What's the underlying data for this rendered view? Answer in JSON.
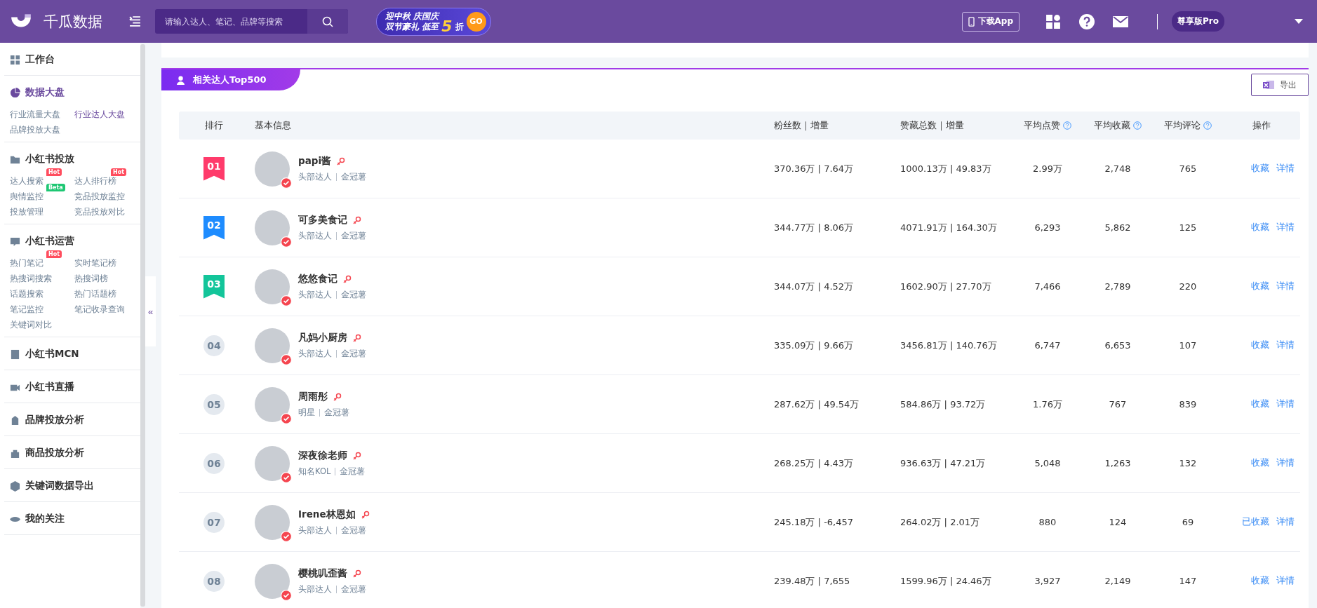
{
  "header": {
    "brand": "千瓜数据",
    "search": {
      "placeholder": "请输入达人、笔记、品牌等搜索"
    },
    "promo": {
      "line_1": "迎中秋 庆国庆",
      "line_2": "双节豪礼 低至",
      "discount": "5",
      "unit": "折",
      "go": "GO"
    },
    "download": "下载App",
    "plan": "尊享版Pro"
  },
  "sidebar": {
    "collapse": "«",
    "sections": [
      {
        "title": "工作台",
        "selected": false
      },
      {
        "title": "数据大盘",
        "selected": true,
        "items": [
          {
            "label": "行业流量大盘",
            "selected": false
          },
          {
            "label": "行业达人大盘",
            "selected": true
          },
          {
            "label": "品牌投放大盘",
            "selected": false
          }
        ]
      },
      {
        "title": "小红书投放",
        "selected": false,
        "items": [
          {
            "label": "达人搜索",
            "selected": false,
            "badge": {
              "text": "Hot",
              "kind": "hot"
            }
          },
          {
            "label": "达人排行榜",
            "selected": false,
            "badge": {
              "text": "Hot",
              "kind": "hot"
            }
          },
          {
            "label": "舆情监控",
            "selected": false,
            "badge": {
              "text": "Beta",
              "kind": "beta"
            }
          },
          {
            "label": "竞品投放监控",
            "selected": false
          },
          {
            "label": "投放管理",
            "selected": false
          },
          {
            "label": "竞品投放对比",
            "selected": false
          }
        ]
      },
      {
        "title": "小红书运营",
        "selected": false,
        "items": [
          {
            "label": "热门笔记",
            "selected": false,
            "badge": {
              "text": "Hot",
              "kind": "hot"
            }
          },
          {
            "label": "实时笔记榜",
            "selected": false
          },
          {
            "label": "热搜词搜索",
            "selected": false
          },
          {
            "label": "热搜词榜",
            "selected": false
          },
          {
            "label": "话题搜索",
            "selected": false
          },
          {
            "label": "热门话题榜",
            "selected": false
          },
          {
            "label": "笔记监控",
            "selected": false
          },
          {
            "label": "笔记收录查询",
            "selected": false
          },
          {
            "label": "关键词对比",
            "selected": false
          }
        ]
      },
      {
        "title": "小红书MCN",
        "selected": false
      },
      {
        "title": "小红书直播",
        "selected": false
      },
      {
        "title": "品牌投放分析",
        "selected": false
      },
      {
        "title": "商品投放分析",
        "selected": false
      },
      {
        "title": "关键词数据导出",
        "selected": false
      },
      {
        "title": "我的关注",
        "selected": false
      }
    ]
  },
  "panel": {
    "tab": "相关达人Top500",
    "export": "导出"
  },
  "table": {
    "columns": [
      {
        "label": "排行",
        "help": false
      },
      {
        "label": "基本信息",
        "help": false
      },
      {
        "label": "粉丝数｜增量",
        "help": false
      },
      {
        "label": "赞藏总数｜增量",
        "help": false
      },
      {
        "label": "平均点赞",
        "help": true
      },
      {
        "label": "平均收藏",
        "help": true
      },
      {
        "label": "平均评论",
        "help": true
      },
      {
        "label": "操作",
        "help": false
      }
    ],
    "rows": [
      {
        "rank": "01",
        "kind": "ribbon",
        "color": "#ff3b6b",
        "name": "papi酱",
        "tags": [
          "头部达人",
          "金冠薯"
        ],
        "fans": "370.36万 | 7.64万",
        "total": "1000.13万 | 49.83万",
        "avg_likes": "2.99万",
        "avg_favs": "2,748",
        "avg_comments": "765",
        "actions": [
          "收藏",
          "详情"
        ]
      },
      {
        "rank": "02",
        "kind": "ribbon",
        "color": "#1e8cff",
        "name": "可多美食记",
        "tags": [
          "头部达人",
          "金冠薯"
        ],
        "fans": "344.77万 | 8.06万",
        "total": "4071.91万 | 164.30万",
        "avg_likes": "6,293",
        "avg_favs": "5,862",
        "avg_comments": "125",
        "actions": [
          "收藏",
          "详情"
        ]
      },
      {
        "rank": "03",
        "kind": "ribbon",
        "color": "#13c59a",
        "name": "悠悠食记",
        "tags": [
          "头部达人",
          "金冠薯"
        ],
        "fans": "344.07万 | 4.52万",
        "total": "1602.90万 | 27.70万",
        "avg_likes": "7,466",
        "avg_favs": "2,789",
        "avg_comments": "220",
        "actions": [
          "收藏",
          "详情"
        ]
      },
      {
        "rank": "04",
        "kind": "circle",
        "name": "凡妈小厨房",
        "tags": [
          "头部达人",
          "金冠薯"
        ],
        "fans": "335.09万 | 9.66万",
        "total": "3456.81万 | 140.76万",
        "avg_likes": "6,747",
        "avg_favs": "6,653",
        "avg_comments": "107",
        "actions": [
          "收藏",
          "详情"
        ]
      },
      {
        "rank": "05",
        "kind": "circle",
        "name": "周雨彤",
        "tags": [
          "明星",
          "金冠薯"
        ],
        "fans": "287.62万 | 49.54万",
        "total": "584.86万 | 93.72万",
        "avg_likes": "1.76万",
        "avg_favs": "767",
        "avg_comments": "839",
        "actions": [
          "收藏",
          "详情"
        ]
      },
      {
        "rank": "06",
        "kind": "circle",
        "name": "深夜徐老师",
        "tags": [
          "知名KOL",
          "金冠薯"
        ],
        "fans": "268.25万 | 4.43万",
        "total": "936.63万 | 47.21万",
        "avg_likes": "5,048",
        "avg_favs": "1,263",
        "avg_comments": "132",
        "actions": [
          "收藏",
          "详情"
        ]
      },
      {
        "rank": "07",
        "kind": "circle",
        "name": "Irene林恩如",
        "tags": [
          "头部达人",
          "金冠薯"
        ],
        "fans": "245.18万 | -6,457",
        "total": "264.02万 | 2.01万",
        "avg_likes": "880",
        "avg_favs": "124",
        "avg_comments": "69",
        "actions": [
          "已收藏",
          "详情"
        ]
      },
      {
        "rank": "08",
        "kind": "circle",
        "name": "樱桃叽歪酱",
        "tags": [
          "头部达人",
          "金冠薯"
        ],
        "fans": "239.48万 | 7,655",
        "total": "1599.96万 | 24.46万",
        "avg_likes": "3,927",
        "avg_favs": "2,149",
        "avg_comments": "147",
        "actions": [
          "收藏",
          "详情"
        ]
      }
    ]
  }
}
